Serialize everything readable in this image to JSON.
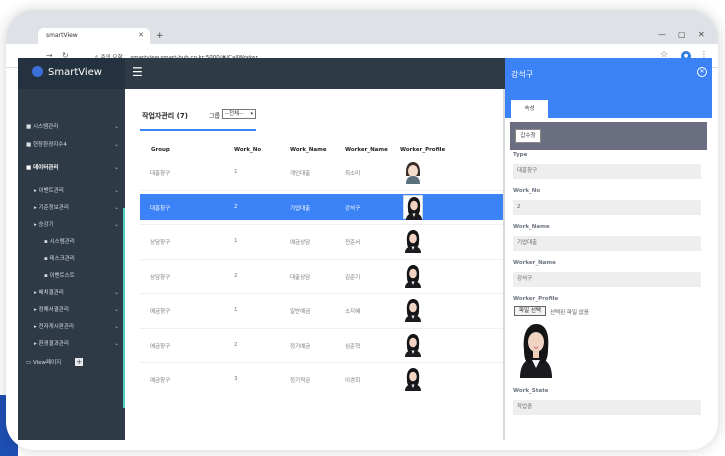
{
  "browser": {
    "tab_title": "smartView",
    "url_warning": "⚠ 주의 요함",
    "url": "smartview.smart-hub.co.kr:5000/#/CallWorker"
  },
  "app": {
    "brand": "SmartView"
  },
  "sidebar": {
    "items": [
      {
        "label": "시스템관리",
        "level": 0
      },
      {
        "label": "현장환경지수4",
        "level": 0
      },
      {
        "label": "데이터관리",
        "level": 0,
        "active": true
      },
      {
        "label": "이벤트관리",
        "level": 1
      },
      {
        "label": "기준정보관리",
        "level": 1
      },
      {
        "label": "승강기",
        "level": 1
      },
      {
        "label": "시스템관리",
        "level": 2
      },
      {
        "label": "테스크관리",
        "level": 2
      },
      {
        "label": "이벤트스트",
        "level": 2
      },
      {
        "label": "배치결관리",
        "level": 1
      },
      {
        "label": "정해서결관리",
        "level": 1
      },
      {
        "label": "전자게시판관리",
        "level": 1
      },
      {
        "label": "환경결과관리",
        "level": 1
      },
      {
        "label": "View페이지",
        "level": 0
      }
    ]
  },
  "main": {
    "title": "작업자관리 (7)",
    "group_label": "그룹",
    "group_select": "--전체--",
    "columns": [
      "Group",
      "Work_No",
      "Work_Name",
      "Worker_Name",
      "Worker_Profile"
    ],
    "rows": [
      {
        "group": "대흥창구",
        "no": "1",
        "work": "개인대출",
        "name": "최소미",
        "avatar": "female-cartoon-icon"
      },
      {
        "group": "대흥창구",
        "no": "2",
        "work": "기업대출",
        "name": "강석구",
        "avatar": "female-photo",
        "selected": true
      },
      {
        "group": "상담창구",
        "no": "1",
        "work": "예금상담",
        "name": "전준서",
        "avatar": "female-photo"
      },
      {
        "group": "상담창구",
        "no": "2",
        "work": "대출상담",
        "name": "김준기",
        "avatar": "female-photo"
      },
      {
        "group": "예금창구",
        "no": "1",
        "work": "일반예금",
        "name": "소지혜",
        "avatar": "female-photo"
      },
      {
        "group": "예금창구",
        "no": "2",
        "work": "정기예금",
        "name": "심준혁",
        "avatar": "female-photo"
      },
      {
        "group": "예금창구",
        "no": "3",
        "work": "정기적금",
        "name": "이경희",
        "avatar": "female-photo"
      }
    ]
  },
  "panel": {
    "title": "강석구",
    "tab": "속성",
    "edit_button": "갑수정",
    "fields": [
      {
        "label": "Type",
        "value": "대흥창구"
      },
      {
        "label": "Work_No",
        "value": "2"
      },
      {
        "label": "Work_Name",
        "value": "기업대출"
      },
      {
        "label": "Worker_Name",
        "value": "강석구"
      }
    ],
    "profile_label": "Worker_Profile",
    "file_button": "파일 선택",
    "file_text": "선택된 파일 없음",
    "state_label": "Work_State",
    "state_value": "작업중"
  },
  "colors": {
    "accent": "#3b82f6",
    "sidebar": "#2e3a46",
    "sidebar_accent": "#4bd2c2"
  }
}
